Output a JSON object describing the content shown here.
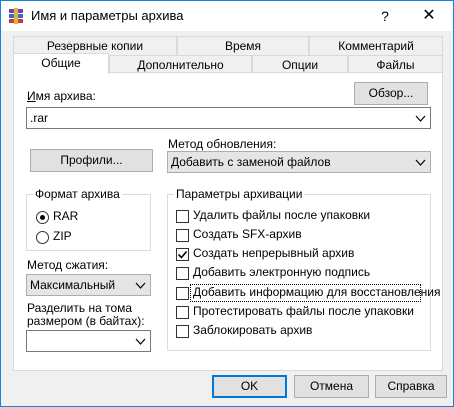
{
  "window": {
    "title": "Имя и параметры архива",
    "help_glyph": "?",
    "close_glyph": "✕"
  },
  "tabs_top": [
    "Резервные копии",
    "Время",
    "Комментарий"
  ],
  "tabs_bottom": [
    "Общие",
    "Дополнительно",
    "Опции",
    "Файлы"
  ],
  "active_tab": "Общие",
  "archive_name": {
    "label": "Имя архива:",
    "value": ".rar",
    "browse_button": "Обзор..."
  },
  "profiles_button": "Профили...",
  "update_method": {
    "label": "Метод обновления:",
    "value": "Добавить с заменой файлов"
  },
  "archive_format": {
    "title": "Формат архива",
    "options": [
      "RAR",
      "ZIP"
    ],
    "selected": "RAR"
  },
  "compression": {
    "label": "Метод сжатия:",
    "value": "Максимальный"
  },
  "split": {
    "label_line1": "Разделить на тома",
    "label_line2": "размером (в байтах):",
    "value": ""
  },
  "archiving_params": {
    "title": "Параметры архивации",
    "options": [
      {
        "label": "Удалить файлы после упаковки",
        "checked": false
      },
      {
        "label": "Создать SFX-архив",
        "checked": false
      },
      {
        "label": "Создать непрерывный архив",
        "checked": true
      },
      {
        "label": "Добавить электронную подпись",
        "checked": false
      },
      {
        "label": "Добавить информацию для восстановления",
        "checked": false
      },
      {
        "label": "Протестировать файлы после упаковки",
        "checked": false
      },
      {
        "label": "Заблокировать архив",
        "checked": false
      }
    ]
  },
  "buttons": {
    "ok": "OK",
    "cancel": "Отмена",
    "help": "Справка"
  },
  "colors": {
    "accent": "#0078d7",
    "window_border": "#1883d7",
    "dialog_bg": "#f0f0f0"
  }
}
